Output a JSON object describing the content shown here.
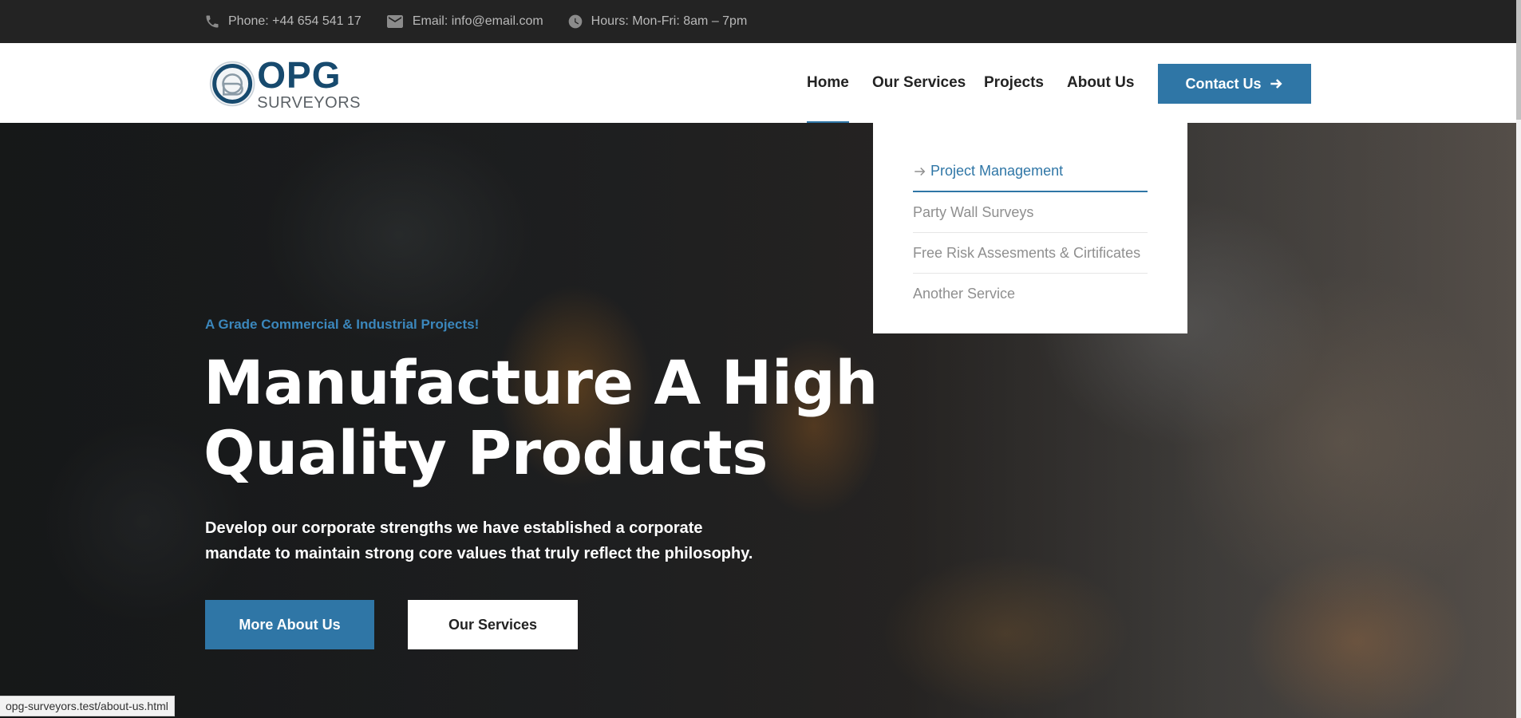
{
  "topbar": {
    "phone": "Phone: +44 654 541 17",
    "email": "Email: info@email.com",
    "hours": "Hours: Mon-Fri: 8am – 7pm"
  },
  "logo": {
    "big": "OPG",
    "small": "SURVEYORS"
  },
  "nav": {
    "items": [
      "Home",
      "Our Services",
      "Projects",
      "About Us"
    ],
    "active": "Home",
    "contact_label": "Contact Us"
  },
  "dropdown": {
    "items": [
      "Project Management",
      "Party Wall Surveys",
      "Free Risk Assesments & Cirtificates",
      "Another Service"
    ],
    "active": "Project Management"
  },
  "hero": {
    "kicker": "A Grade Commercial & Industrial Projects!",
    "title_line1": "Manufacture A High",
    "title_line2": "Quality Products",
    "desc_line1": "Develop our corporate strengths we have established a corporate",
    "desc_line2": "mandate to maintain strong core values that truly reflect the philosophy.",
    "btn_primary": "More About Us",
    "btn_secondary": "Our Services"
  },
  "status_url": "opg-surveyors.test/about-us.html",
  "colors": {
    "accent": "#2f76a6",
    "topbar": "#232323",
    "logo": "#174a6e"
  }
}
